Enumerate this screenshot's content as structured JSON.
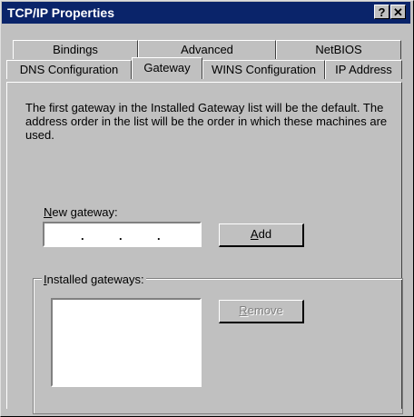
{
  "window": {
    "title": "TCP/IP Properties",
    "help_button": "?",
    "close_button": "✕"
  },
  "tabs_row1": [
    "Bindings",
    "Advanced",
    "NetBIOS"
  ],
  "tabs_row2": [
    "DNS Configuration",
    "Gateway",
    "WINS Configuration",
    "IP Address"
  ],
  "active_tab": "Gateway",
  "description": "The first gateway in the Installed Gateway list will be the default. The address order in the list will be the order in which these machines are used.",
  "new_gateway": {
    "label_hotkey": "N",
    "label_rest": "ew gateway:",
    "ip_separator": "."
  },
  "buttons": {
    "add_hotkey": "A",
    "add_rest": "dd",
    "remove_hotkey": "R",
    "remove_rest": "emove"
  },
  "installed_gateways": {
    "label_hotkey": "I",
    "label_rest": "nstalled gateways:",
    "items": []
  }
}
